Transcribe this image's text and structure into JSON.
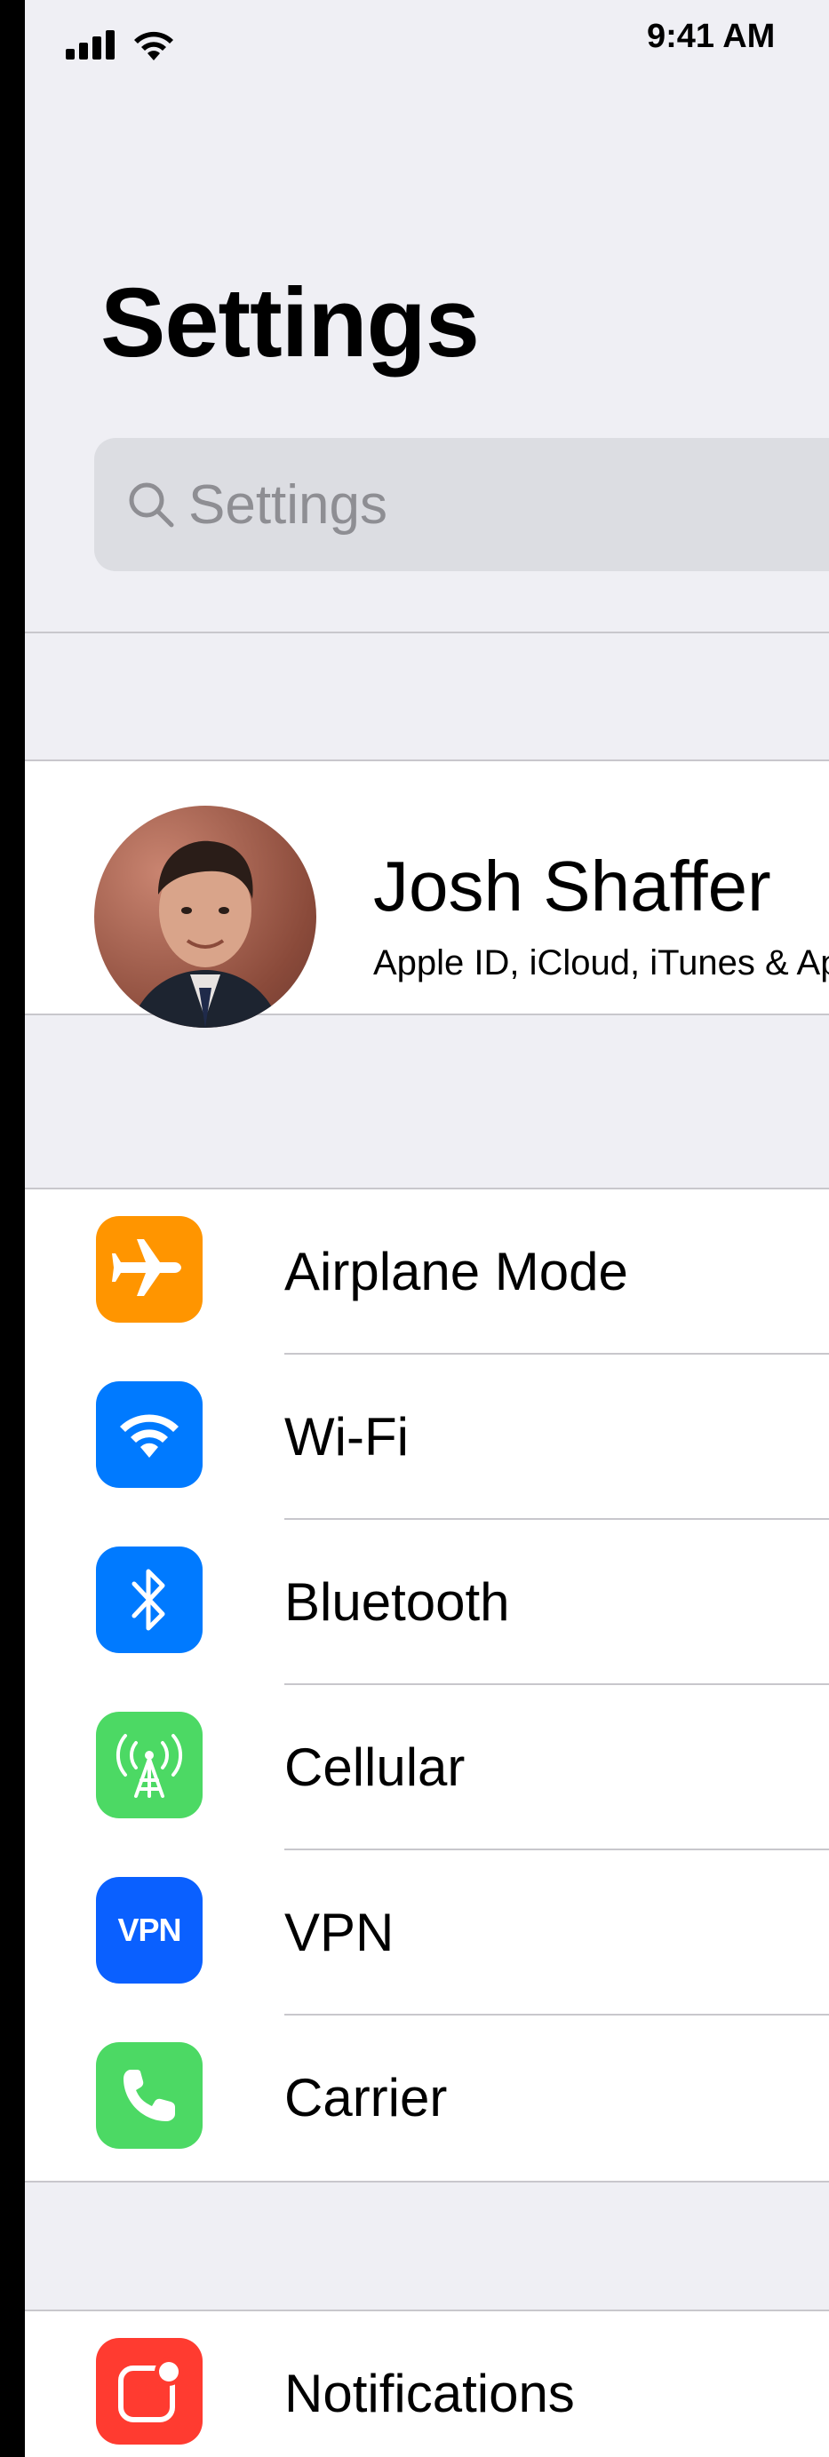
{
  "status_bar": {
    "time": "9:41 AM"
  },
  "header": {
    "title": "Settings"
  },
  "search": {
    "placeholder": "Settings"
  },
  "profile": {
    "name": "Josh Shaffer",
    "subtitle": "Apple ID, iCloud, iTunes & App Store"
  },
  "settings_list": [
    {
      "label": "Airplane Mode",
      "icon": "airplane-icon",
      "color": "#ff9500"
    },
    {
      "label": "Wi-Fi",
      "icon": "wifi-icon",
      "color": "#007aff"
    },
    {
      "label": "Bluetooth",
      "icon": "bluetooth-icon",
      "color": "#007aff"
    },
    {
      "label": "Cellular",
      "icon": "cellular-antenna-icon",
      "color": "#4cd964"
    },
    {
      "label": "VPN",
      "icon": "vpn-icon",
      "color": "#0a60ff",
      "icon_text": "VPN"
    },
    {
      "label": "Carrier",
      "icon": "phone-icon",
      "color": "#4cd964"
    }
  ],
  "settings_list_2": [
    {
      "label": "Notifications",
      "icon": "notifications-icon",
      "color": "#ff3b30"
    }
  ]
}
